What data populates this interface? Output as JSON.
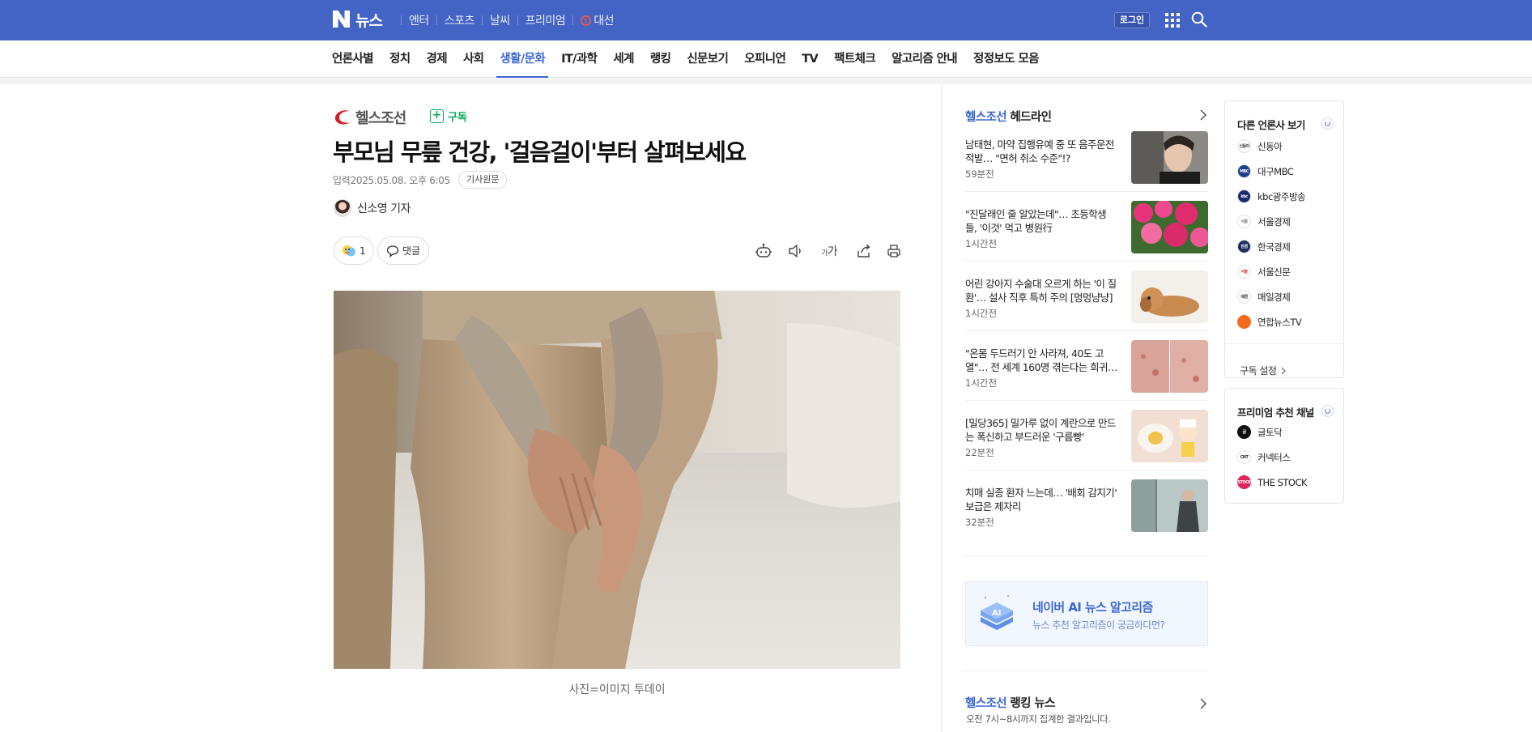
{
  "gnb": {
    "title": "뉴스",
    "links": [
      "엔터",
      "스포츠",
      "날씨",
      "프리미엄"
    ],
    "election_label": "대선",
    "login_label": "로그인",
    "colors": {
      "bar": "#4364c4",
      "election_icon": "#ff5a3c"
    }
  },
  "lnb": {
    "items": [
      "언론사별",
      "정치",
      "경제",
      "사회",
      "생활/문화",
      "IT/과학",
      "세계",
      "랭킹",
      "신문보기",
      "오피니언",
      "TV",
      "팩트체크",
      "알고리즘 안내",
      "정정보도 모음"
    ],
    "active_index": 4,
    "accent": "#3b68d1"
  },
  "article": {
    "press_name": "헬스조선",
    "subscribe_label": "구독",
    "headline": "부모님 무릎 건강, '걸음걸이'부터 살펴보세요",
    "date_label": "입력",
    "date_value": "2025.05.08. 오후 6:05",
    "original_button": "기사원문",
    "reporter": "신소영 기자",
    "reaction_count": "1",
    "comment_label": "댓글",
    "toolbar_icons": [
      "summary-bot-icon",
      "speaker-icon",
      "font-size-icon",
      "share-icon",
      "print-icon"
    ],
    "font_size_glyph_small": "가",
    "font_size_glyph_big": "가",
    "photo_caption": "사진=이미지 투데이"
  },
  "headlines": {
    "press": "헬스조선",
    "title_suffix": "헤드라인",
    "items": [
      {
        "title": "남태현, 마약 집행유예 중 또 음주운전 적발… \"면허 취소 수준\"!?",
        "time": "59분전"
      },
      {
        "title": "\"진달래인 줄 알았는데\"… 초등학생들, '이것' 먹고 병원行",
        "time": "1시간전"
      },
      {
        "title": "어린 강아지 수술대 오르게 하는 '이 질환'… 설사 직후 특히 주의 [멍멍냥냥]",
        "time": "1시간전"
      },
      {
        "title": "\"온몸 두드러기 안 사라져, 40도 고열\"… 전 세계 160명 겪는다는 희귀…",
        "time": "1시간전"
      },
      {
        "title": "[밀당365] 밀가루 없이 계란으로 만드는 폭신하고 부드러운 '구름빵'",
        "time": "22분전"
      },
      {
        "title": "치매 실종 환자 느는데… '배회 감지기' 보급은 제자리",
        "time": "32분전"
      }
    ]
  },
  "ai_banner": {
    "title": "네이버 AI 뉴스 알고리즘",
    "subtitle": "뉴스 추천 알고리즘이 궁금하다면?",
    "icon_text": "AI"
  },
  "ranking": {
    "press": "헬스조선",
    "title_suffix": "랭킹 뉴스",
    "subtitle": "오전 7시~8시까지 집계한 결과입니다."
  },
  "other_press": {
    "title": "다른 언론사 보기",
    "items": [
      {
        "name": "신동아",
        "badge": "신동아",
        "color": "#ffffff",
        "text_color": "#333333"
      },
      {
        "name": "대구MBC",
        "badge": "MBC",
        "color": "#1e3c8c",
        "text_color": "#ffffff"
      },
      {
        "name": "kbc광주방송",
        "badge": "kbc",
        "color": "#1b2a6b",
        "text_color": "#ffffff"
      },
      {
        "name": "서울경제",
        "badge": "서울",
        "color": "#ffffff",
        "text_color": "#777777"
      },
      {
        "name": "한국경제",
        "badge": "한경",
        "color": "#1d2f5e",
        "text_color": "#ffffff"
      },
      {
        "name": "서울신문",
        "badge": "서울",
        "color": "#ffffff",
        "text_color": "#d23b2a"
      },
      {
        "name": "매일경제",
        "badge": "매경",
        "color": "#ffffff",
        "text_color": "#333333"
      },
      {
        "name": "연합뉴스TV",
        "badge": "",
        "color": "#f26b1d",
        "text_color": "#ffffff"
      }
    ],
    "setting_label": "구독 설정"
  },
  "premium": {
    "title": "프리미엄 추천 채널",
    "items": [
      {
        "name": "글토닥",
        "badge": "글",
        "color": "#111111",
        "text_color": "#ffffff"
      },
      {
        "name": "커넥터스",
        "badge": "CNT",
        "color": "#ffffff",
        "text_color": "#333333"
      },
      {
        "name": "THE STOCK",
        "badge": "STOCK",
        "color": "#e0245e",
        "text_color": "#ffffff"
      }
    ]
  }
}
